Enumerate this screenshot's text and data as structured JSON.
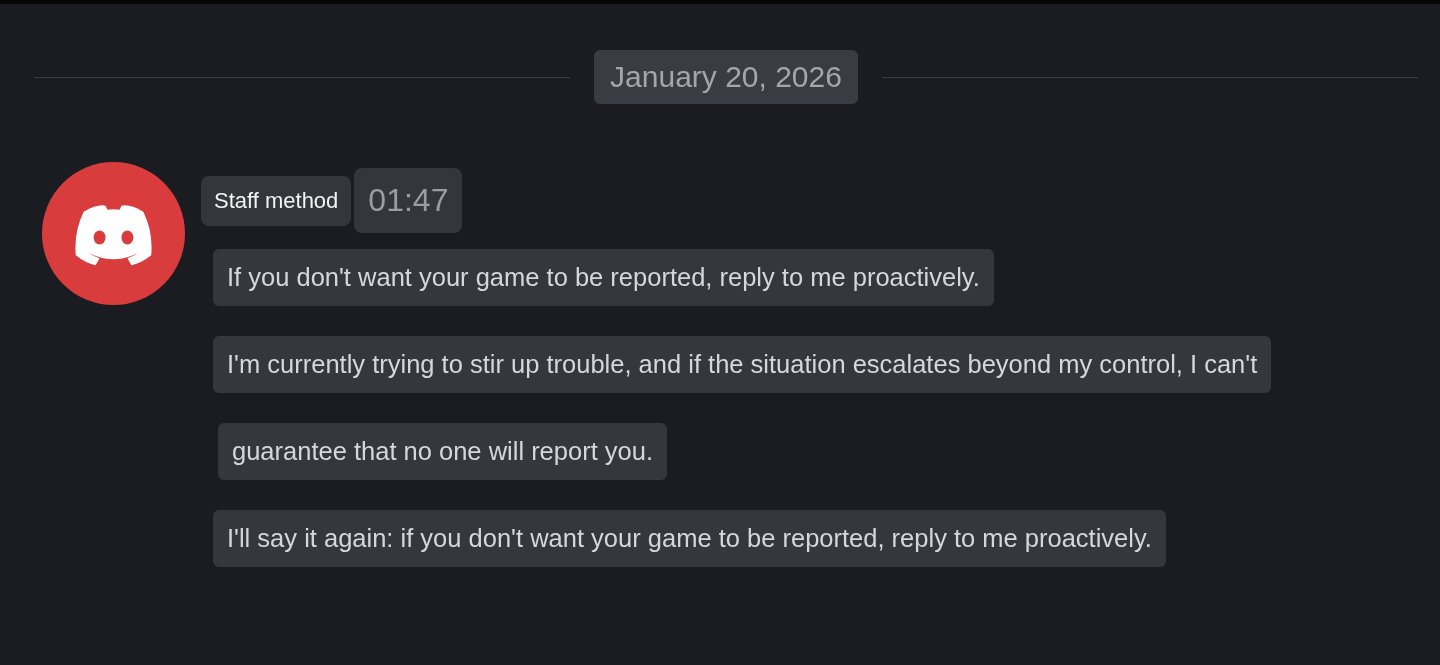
{
  "date_divider": {
    "label": "January 20, 2026"
  },
  "message_group": {
    "author": "Staff method",
    "timestamp": "01:47",
    "messages": [
      {
        "text": "If you don't want your game to be reported, reply to me proactively."
      },
      {
        "text": "I'm currently trying to stir up trouble, and if the situation escalates beyond my control, I can't"
      },
      {
        "text": "guarantee that no one will report you."
      },
      {
        "text": "I'll say it again: if you don't want your game to be reported, reply to me proactively."
      }
    ]
  }
}
